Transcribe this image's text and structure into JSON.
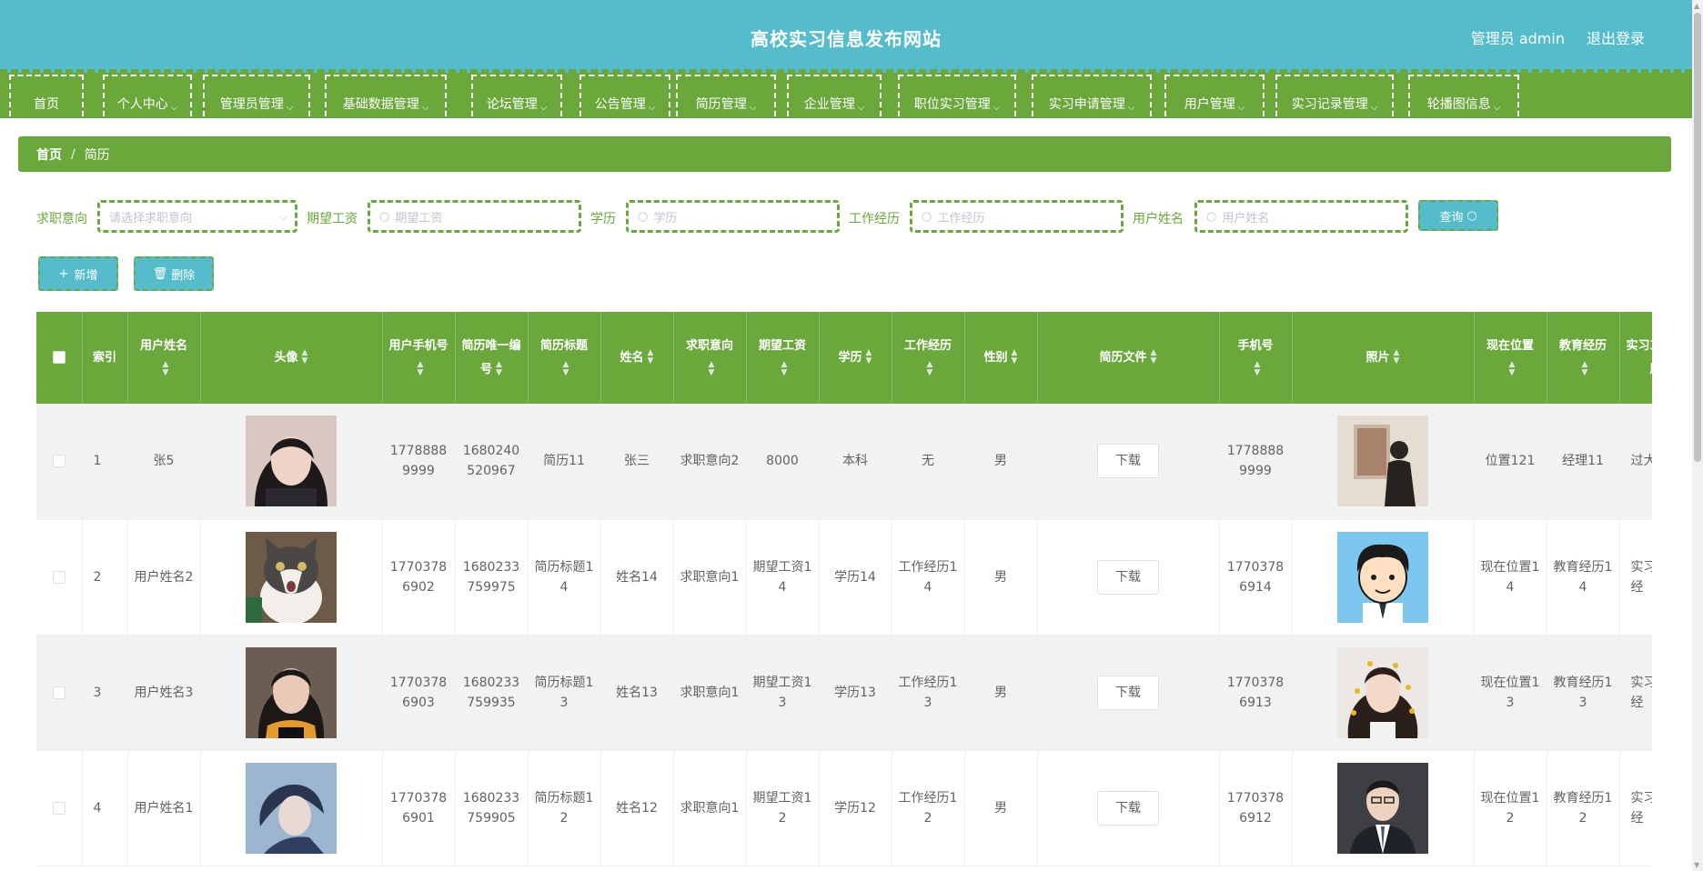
{
  "header": {
    "title": "高校实习信息发布网站",
    "user": "管理员 admin",
    "logout": "退出登录"
  },
  "nav": [
    {
      "label": "首页",
      "chevron": false
    },
    {
      "label": "个人中心",
      "chevron": true
    },
    {
      "label": "管理员管理",
      "chevron": true
    },
    {
      "label": "基础数据管理",
      "chevron": true
    },
    {
      "label": "论坛管理",
      "chevron": true
    },
    {
      "label": "公告管理",
      "chevron": true
    },
    {
      "label": "简历管理",
      "chevron": true
    },
    {
      "label": "企业管理",
      "chevron": true
    },
    {
      "label": "职位实习管理",
      "chevron": true
    },
    {
      "label": "实习申请管理",
      "chevron": true
    },
    {
      "label": "用户管理",
      "chevron": true
    },
    {
      "label": "实习记录管理",
      "chevron": true
    },
    {
      "label": "轮播图信息",
      "chevron": true
    }
  ],
  "breadcrumb": {
    "home": "首页",
    "sep": "/",
    "current": "简历"
  },
  "search": {
    "intent_label": "求职意向",
    "intent_placeholder": "请选择求职意向",
    "salary_label": "期望工资",
    "salary_placeholder": "期望工资",
    "edu_label": "学历",
    "edu_placeholder": "学历",
    "exp_label": "工作经历",
    "exp_placeholder": "工作经历",
    "name_label": "用户姓名",
    "name_placeholder": "用户姓名",
    "query_button": "查询"
  },
  "actions": {
    "add": "新增",
    "delete": "删除"
  },
  "table": {
    "headers": {
      "index": "索引",
      "username": "用户姓名",
      "avatar": "头像",
      "phone": "用户手机号",
      "resume_id": "简历唯一编号",
      "resume_title": "简历标题",
      "name": "姓名",
      "intent": "求职意向",
      "salary": "期望工资",
      "edu": "学历",
      "exp": "工作经历",
      "gender": "性别",
      "file": "简历文件",
      "mobile": "手机号",
      "photo": "照片",
      "location": "现在位置",
      "education": "教育经历",
      "internship": "实习工作经历"
    },
    "download_label": "下载",
    "rows": [
      {
        "index": "1",
        "username": "张5",
        "phone": "17788889999",
        "resume_id": "1680240520967",
        "resume_title": "简历11",
        "name": "张三",
        "intent": "求职意向2",
        "salary": "8000",
        "edu": "本科",
        "exp": "无",
        "gender": "男",
        "mobile": "17788889999",
        "location": "位置121",
        "education": "经理11",
        "internship": "过大多",
        "avatar_icon": "girl-portrait",
        "photo_icon": "man-back-photo"
      },
      {
        "index": "2",
        "username": "用户姓名2",
        "phone": "17703786902",
        "resume_id": "1680233759975",
        "resume_title": "简历标题14",
        "name": "姓名14",
        "intent": "求职意向1",
        "salary": "期望工资14",
        "edu": "学历14",
        "exp": "工作经历14",
        "gender": "男",
        "mobile": "17703786914",
        "location": "现在位置14",
        "education": "教育经历14",
        "internship": "实习工作经",
        "avatar_icon": "cat-photo",
        "photo_icon": "cartoon-boy"
      },
      {
        "index": "3",
        "username": "用户姓名3",
        "phone": "17703786903",
        "resume_id": "1680233759935",
        "resume_title": "简历标题13",
        "name": "姓名13",
        "intent": "求职意向1",
        "salary": "期望工资13",
        "edu": "学历13",
        "exp": "工作经历13",
        "gender": "男",
        "mobile": "17703786913",
        "location": "现在位置13",
        "education": "教育经历13",
        "internship": "实习工作经",
        "avatar_icon": "girl-portrait-2",
        "photo_icon": "curly-girl"
      },
      {
        "index": "4",
        "username": "用户姓名1",
        "phone": "17703786901",
        "resume_id": "1680233759905",
        "resume_title": "简历标题12",
        "name": "姓名12",
        "intent": "求职意向1",
        "salary": "期望工资12",
        "edu": "学历12",
        "exp": "工作经历12",
        "gender": "男",
        "mobile": "17703786912",
        "location": "现在位置12",
        "education": "教育经历12",
        "internship": "实习工作经",
        "avatar_icon": "anime-boy",
        "photo_icon": "man-suit"
      }
    ]
  },
  "colors": {
    "header": "#54bccb",
    "accent": "#6aa83b",
    "row_alt": "#f2f2f2"
  }
}
